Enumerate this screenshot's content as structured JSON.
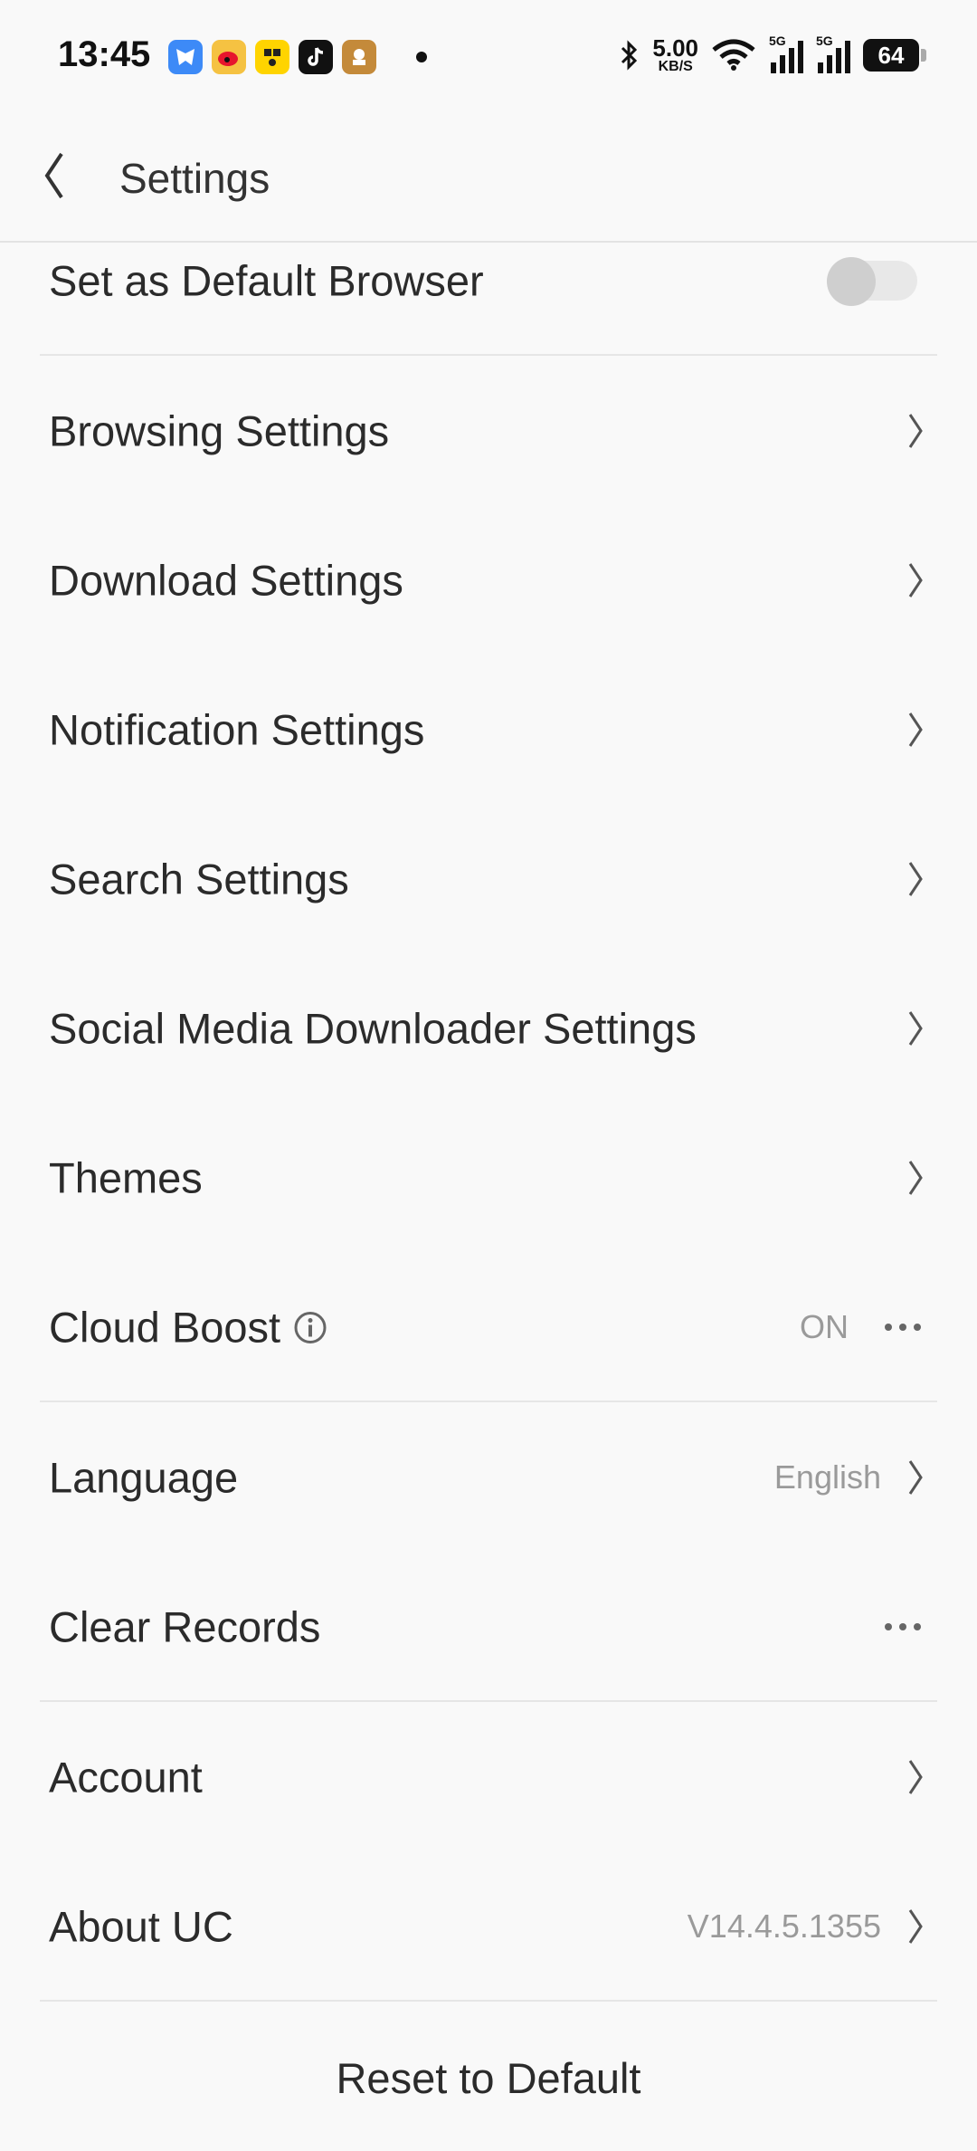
{
  "status": {
    "time": "13:45",
    "net_speed_value": "5.00",
    "net_speed_unit": "KB/S",
    "sig1_label": "5G",
    "sig2_label": "5G",
    "battery": "64",
    "app_icons": [
      "tencent-icon",
      "weibo-icon",
      "qq-music-icon",
      "tiktok-icon",
      "game-icon"
    ]
  },
  "header": {
    "title": "Settings"
  },
  "rows": [
    {
      "label": "Set as Default Browser",
      "control": "toggle",
      "toggle_on": false
    },
    {
      "label": "Browsing Settings",
      "control": "chevron"
    },
    {
      "label": "Download Settings",
      "control": "chevron"
    },
    {
      "label": "Notification Settings",
      "control": "chevron"
    },
    {
      "label": "Search Settings",
      "control": "chevron"
    },
    {
      "label": "Social Media Downloader Settings",
      "control": "chevron"
    },
    {
      "label": "Themes",
      "control": "chevron"
    },
    {
      "label": "Cloud Boost",
      "value": "ON",
      "control": "more"
    },
    {
      "label": "Language",
      "value": "English",
      "control": "chevron"
    },
    {
      "label": "Clear Records",
      "control": "more"
    },
    {
      "label": "Account",
      "control": "chevron"
    },
    {
      "label": "About UC",
      "value": "V14.4.5.1355",
      "control": "chevron"
    }
  ],
  "footer": {
    "reset_label": "Reset to Default"
  },
  "colors": {
    "background": "#f9f9f9",
    "text": "#2b2b2b",
    "muted": "#9a9a9a",
    "divider": "#e6e6e6"
  }
}
